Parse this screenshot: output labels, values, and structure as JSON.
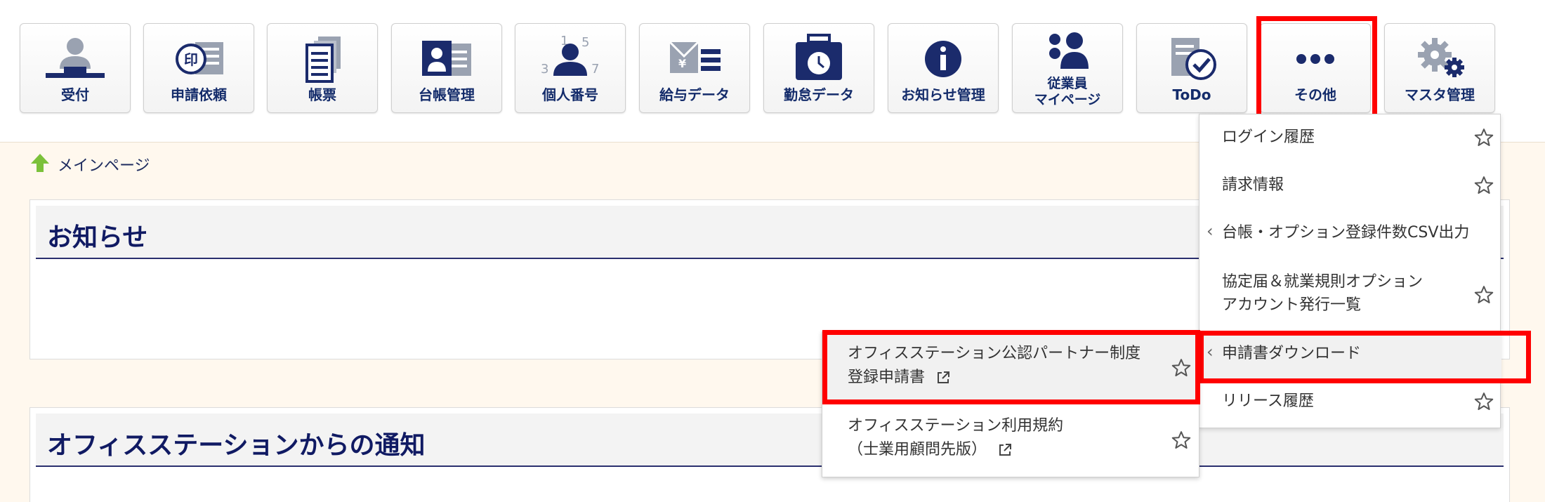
{
  "toolbar": {
    "buttons": [
      {
        "label": "受付",
        "icon": "reception-icon"
      },
      {
        "label": "申請依頼",
        "icon": "stamp-request-icon"
      },
      {
        "label": "帳票",
        "icon": "forms-icon"
      },
      {
        "label": "台帳管理",
        "icon": "ledger-icon"
      },
      {
        "label": "個人番号",
        "icon": "personal-number-icon"
      },
      {
        "label": "給与データ",
        "icon": "salary-icon"
      },
      {
        "label": "勤怠データ",
        "icon": "attendance-icon"
      },
      {
        "label": "お知らせ管理",
        "icon": "info-icon"
      },
      {
        "label": "従業員\nマイページ",
        "icon": "employees-icon"
      },
      {
        "label": "ToDo",
        "icon": "todo-icon"
      },
      {
        "label": "その他",
        "icon": "more-icon"
      },
      {
        "label": "マスタ管理",
        "icon": "gear-icon"
      }
    ]
  },
  "breadcrumb": {
    "label": "メインページ"
  },
  "panels": {
    "notice": {
      "title": "お知らせ"
    },
    "notification": {
      "title": "オフィスステーションからの通知"
    }
  },
  "menu": {
    "items": [
      {
        "label": "ログイン履歴",
        "has_star": true
      },
      {
        "label": "請求情報",
        "has_star": true
      },
      {
        "label": "台帳・オプション登録件数CSV出力",
        "has_chevron": true
      },
      {
        "label": "協定届＆就業規則オプション\nアカウント発行一覧",
        "has_star": true
      },
      {
        "label": "申請書ダウンロード",
        "has_chevron": true
      },
      {
        "label": "リリース履歴",
        "has_star": true
      }
    ]
  },
  "submenu": {
    "items": [
      {
        "label_line1": "オフィスステーション公認パートナー制度",
        "label_line2": "登録申請書"
      },
      {
        "label_line1": "オフィスステーション利用規約",
        "label_line2": "（士業用顧問先版）"
      }
    ]
  },
  "colors": {
    "accent": "#142c6b",
    "highlight": "#ff0000",
    "content_bg": "#fff8ee"
  }
}
